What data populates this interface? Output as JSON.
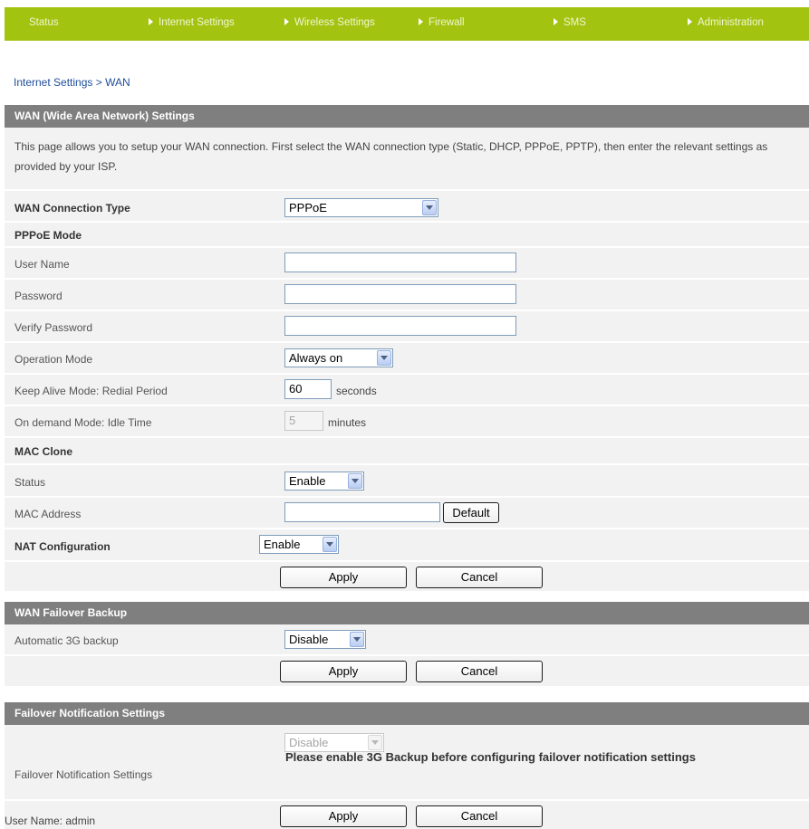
{
  "nav": {
    "status": "Status",
    "internet_settings": "Internet Settings",
    "wireless_settings": "Wireless Settings",
    "firewall": "Firewall",
    "sms": "SMS",
    "administration": "Administration"
  },
  "breadcrumb": "Internet Settings > WAN",
  "wan": {
    "header": "WAN (Wide Area Network) Settings",
    "description": "This page allows you to setup your WAN connection. First select the WAN connection type (Static, DHCP, PPPoE, PPTP), then enter the relevant settings as provided by your ISP.",
    "connection_type_label": "WAN Connection Type",
    "connection_type_value": "PPPoE",
    "pppoe_mode_label": "PPPoE Mode",
    "user_name_label": "User Name",
    "user_name_value": "",
    "password_label": "Password",
    "password_value": "",
    "verify_password_label": "Verify Password",
    "verify_password_value": "",
    "operation_mode_label": "Operation Mode",
    "operation_mode_value": "Always on",
    "keep_alive_label": "Keep Alive Mode: Redial Period",
    "keep_alive_value": "60",
    "keep_alive_unit": "seconds",
    "on_demand_label": "On demand Mode: Idle Time",
    "on_demand_value": "5",
    "on_demand_unit": "minutes",
    "mac_clone_label": "MAC Clone",
    "status_label": "Status",
    "status_value": "Enable",
    "mac_address_label": "MAC Address",
    "mac_address_value": "",
    "default_button": "Default",
    "nat_label": "NAT Configuration",
    "nat_value": "Enable",
    "apply": "Apply",
    "cancel": "Cancel"
  },
  "failover": {
    "header": "WAN Failover Backup",
    "auto_backup_label": "Automatic 3G backup",
    "auto_backup_value": "Disable",
    "apply": "Apply",
    "cancel": "Cancel"
  },
  "notification": {
    "header": "Failover Notification Settings",
    "label": "Failover Notification Settings",
    "value": "Disable",
    "warning": "Please enable 3G Backup before configuring failover notification settings",
    "apply": "Apply",
    "cancel": "Cancel"
  },
  "footer": {
    "user_label": "User Name:",
    "user_value": "admin"
  }
}
